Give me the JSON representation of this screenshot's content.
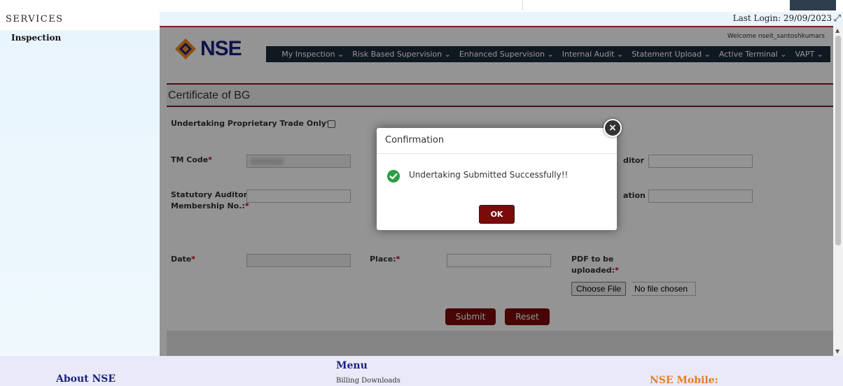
{
  "services": {
    "title": "SERVICES",
    "items": [
      "Inspection"
    ]
  },
  "header": {
    "last_login": "Last Login: 29/09/2023",
    "welcome": "Welcome nseit_santoshkumars",
    "logo_text": "NSE"
  },
  "nav": {
    "items": [
      "My Inspection ⌄",
      "Risk Based Supervision ⌄",
      "Enhanced Supervision ⌄",
      "Internal Audit ⌄",
      "Statement Upload ⌄",
      "Active Terminal ⌄",
      "VAPT ⌄"
    ]
  },
  "form": {
    "title": "Certificate of BG",
    "undertaking_label": "Undertaking Proprietary Trade Only",
    "tm_code_label": "TM Code",
    "auditor_label_fragment": "ditor",
    "statutory_label_1": "Statutory Auditor",
    "statutory_label_2": "Membership No.:",
    "mid_label_fragment": "ation",
    "date_label": "Date",
    "place_label": "Place:",
    "pdf_label_1": "PDF to be",
    "pdf_label_2": "uploaded:",
    "required_mark": "*",
    "choose_file": "Choose File",
    "no_file": "No file chosen",
    "submit": "Submit",
    "reset": "Reset"
  },
  "modal": {
    "title": "Confirmation",
    "message": "Undertaking Submitted Successfully!!",
    "ok": "OK",
    "close": "×"
  },
  "footer": {
    "about": "About NSE",
    "menu": "Menu",
    "billing": "Billing Downloads",
    "mobile": "NSE Mobile:"
  },
  "colors": {
    "accent": "#7b0a0a",
    "navbar": "#1d2b3a",
    "brand_blue": "#1a237e",
    "success": "#2e9e44"
  }
}
